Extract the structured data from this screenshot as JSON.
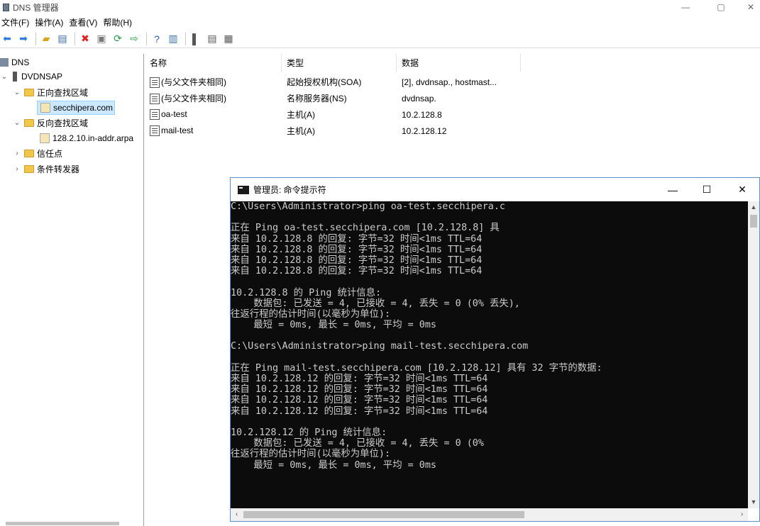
{
  "window": {
    "title": "DNS 管理器",
    "minimize": "—",
    "restore": "▢",
    "close": "✕"
  },
  "menu": [
    "文件(F)",
    "操作(A)",
    "查看(V)",
    "帮助(H)"
  ],
  "toolbar": {
    "icons": [
      "back-icon",
      "forward-icon",
      "up-folder-icon",
      "show-hide-console-tree-icon",
      "delete-icon",
      "properties-icon",
      "refresh-icon",
      "export-list-icon",
      "help-icon",
      "action-pane-icon",
      "server-icon",
      "record-list-icon",
      "record-detail-icon"
    ]
  },
  "tree": {
    "root": "DNS",
    "server": "DVDNSAP",
    "forward_zones": "正向查找区域",
    "forward_zone_item": "secchipera.com",
    "reverse_zones": "反向查找区域",
    "reverse_zone_item": "128.2.10.in-addr.arpa",
    "trust_points": "信任点",
    "conditional_forwarders": "条件转发器"
  },
  "list": {
    "columns": [
      "名称",
      "类型",
      "数据"
    ],
    "rows": [
      {
        "name": "(与父文件夹相同)",
        "type": "起始授权机构(SOA)",
        "data": "[2], dvdnsap., hostmast..."
      },
      {
        "name": "(与父文件夹相同)",
        "type": "名称服务器(NS)",
        "data": "dvdnsap."
      },
      {
        "name": "oa-test",
        "type": "主机(A)",
        "data": "10.2.128.8"
      },
      {
        "name": "mail-test",
        "type": "主机(A)",
        "data": "10.2.128.12"
      }
    ]
  },
  "cmd": {
    "title": "管理员: 命令提示符",
    "minimize": "—",
    "maximize": "☐",
    "close": "✕",
    "lines": [
      "C:\\Users\\Administrator>ping oa-test.secchipera.c",
      "",
      "正在 Ping oa-test.secchipera.com [10.2.128.8] 具",
      "来自 10.2.128.8 的回复: 字节=32 时间<1ms TTL=64",
      "来自 10.2.128.8 的回复: 字节=32 时间<1ms TTL=64",
      "来自 10.2.128.8 的回复: 字节=32 时间<1ms TTL=64",
      "来自 10.2.128.8 的回复: 字节=32 时间<1ms TTL=64",
      "",
      "10.2.128.8 的 Ping 统计信息:",
      "    数据包: 已发送 = 4, 已接收 = 4, 丢失 = 0 (0% 丢失),",
      "往返行程的估计时间(以毫秒为单位):",
      "    最短 = 0ms, 最长 = 0ms, 平均 = 0ms",
      "",
      "C:\\Users\\Administrator>ping mail-test.secchipera.com",
      "",
      "正在 Ping mail-test.secchipera.com [10.2.128.12] 具有 32 字节的数据:",
      "来自 10.2.128.12 的回复: 字节=32 时间<1ms TTL=64",
      "来自 10.2.128.12 的回复: 字节=32 时间<1ms TTL=64",
      "来自 10.2.128.12 的回复: 字节=32 时间<1ms TTL=64",
      "来自 10.2.128.12 的回复: 字节=32 时间<1ms TTL=64",
      "",
      "10.2.128.12 的 Ping 统计信息:",
      "    数据包: 已发送 = 4, 已接收 = 4, 丢失 = 0 (0%",
      "往返行程的估计时间(以毫秒为单位):",
      "    最短 = 0ms, 最长 = 0ms, 平均 = 0ms"
    ]
  },
  "colors": {
    "accent": "#5a8fcf",
    "selection": "#cce8ff",
    "console_bg": "#0c0c0c",
    "console_fg": "#cccccc"
  }
}
